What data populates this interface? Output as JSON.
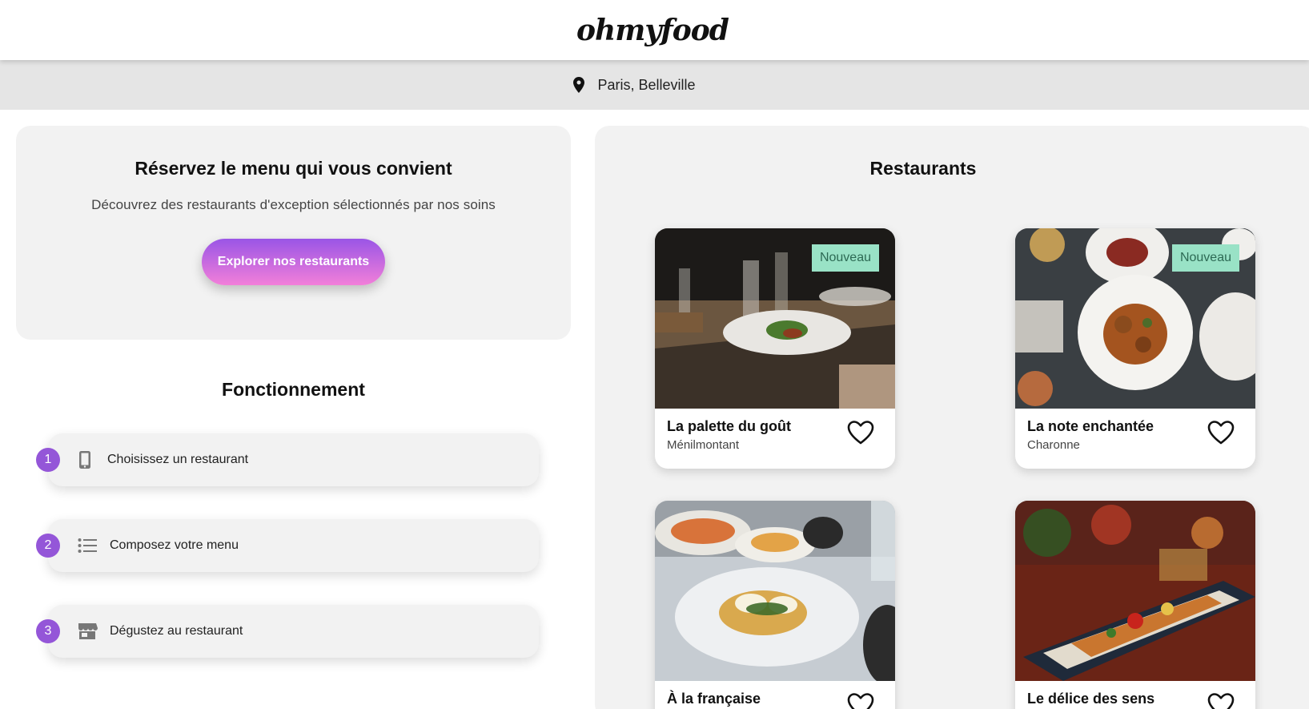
{
  "header": {
    "logo": "ohmyfood"
  },
  "location": {
    "icon": "map-pin-icon",
    "text": "Paris, Belleville"
  },
  "hero": {
    "title": "Réservez le menu qui vous convient",
    "subtitle": "Découvrez des restaurants d'exception sélectionnés par nos soins",
    "cta_label": "Explorer nos restaurants"
  },
  "how_it_works": {
    "title": "Fonctionnement",
    "steps": [
      {
        "number": "1",
        "icon": "mobile-phone-icon",
        "label": "Choisissez un restaurant"
      },
      {
        "number": "2",
        "icon": "list-icon",
        "label": "Composez votre menu"
      },
      {
        "number": "3",
        "icon": "store-icon",
        "label": "Dégustez au restaurant"
      }
    ]
  },
  "restaurants": {
    "title": "Restaurants",
    "cards": [
      {
        "name": "La palette du goût",
        "location": "Ménilmontant",
        "badge": "Nouveau"
      },
      {
        "name": "La note enchantée",
        "location": "Charonne",
        "badge": "Nouveau"
      },
      {
        "name": "À la française",
        "location": "",
        "badge": ""
      },
      {
        "name": "Le délice des sens",
        "location": "",
        "badge": ""
      }
    ]
  },
  "colors": {
    "accent_purple": "#9456d8",
    "accent_pink": "#f27fd9",
    "badge_green": "#99e2c6"
  }
}
